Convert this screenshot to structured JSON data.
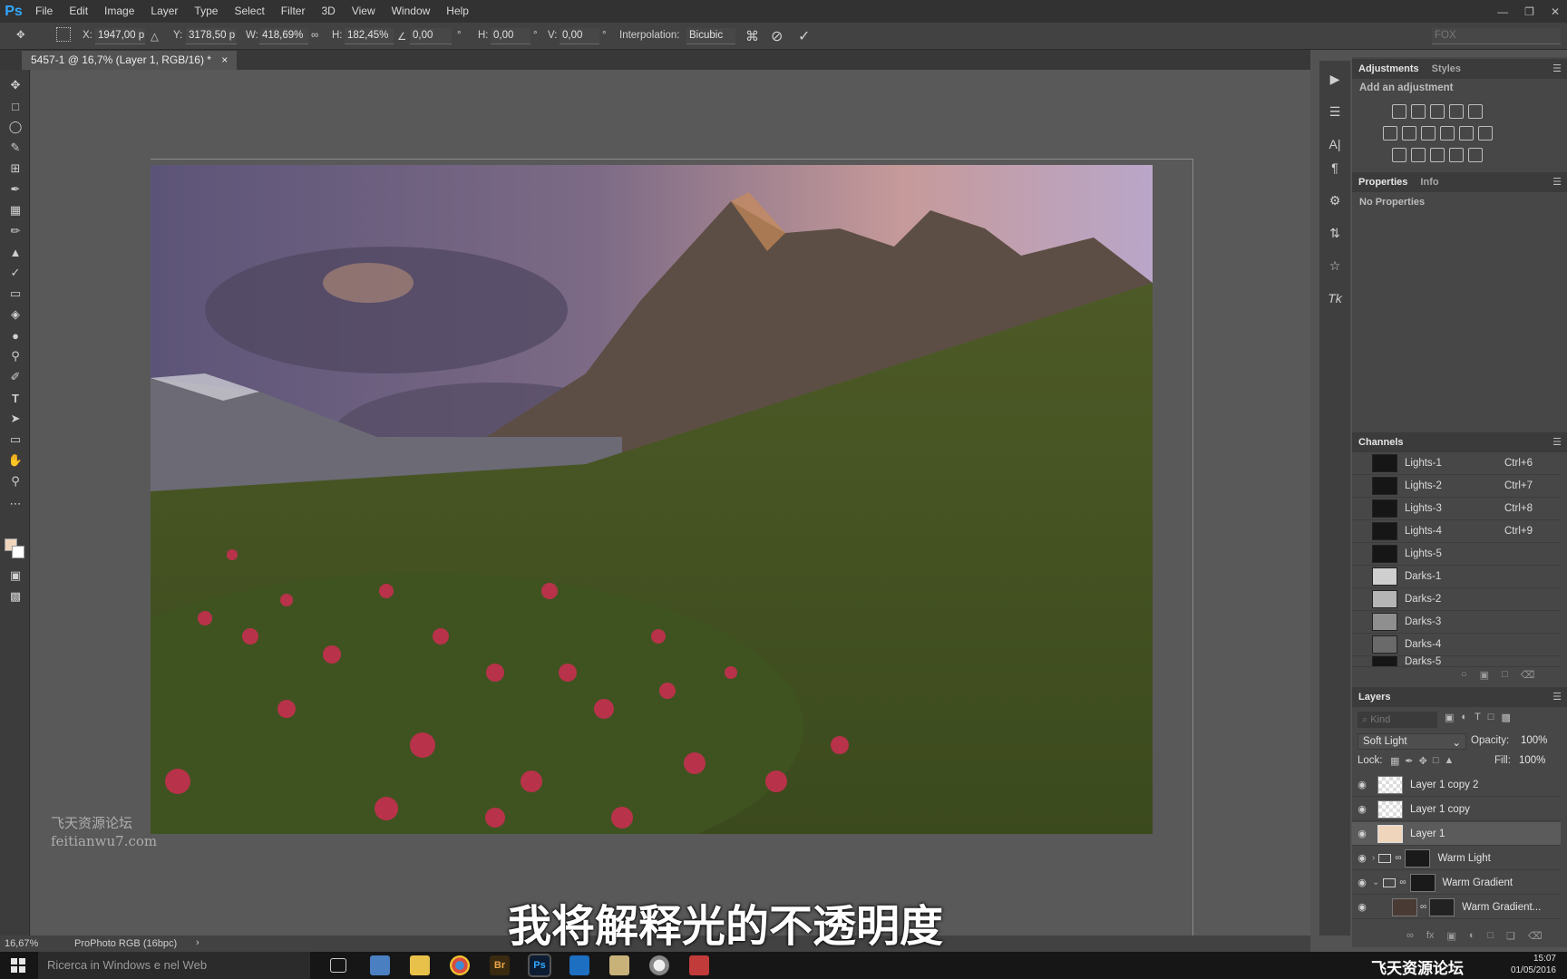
{
  "app": {
    "name": "Ps"
  },
  "menubar": {
    "items": [
      "File",
      "Edit",
      "Image",
      "Layer",
      "Type",
      "Select",
      "Filter",
      "3D",
      "View",
      "Window",
      "Help"
    ]
  },
  "options": {
    "x_label": "X:",
    "x_value": "1947,00 p",
    "y_label": "Y:",
    "y_value": "3178,50 p",
    "w_label": "W:",
    "w_value": "418,69%",
    "h_label": "H:",
    "h_value": "182,45%",
    "angle_value": "0,00",
    "angle_unit": "°",
    "hskew_label": "H:",
    "hskew_value": "0,00",
    "hskew_unit": "°",
    "vskew_label": "V:",
    "vskew_value": "0,00",
    "vskew_unit": "°",
    "interp_label": "Interpolation:",
    "interp_value": "Bicubic",
    "right_field": "FOX"
  },
  "document": {
    "tab_title": "5457-1 @ 16,7% (Layer 1, RGB/16) *",
    "close": "×"
  },
  "status": {
    "zoom": "16,67%",
    "profile": "ProPhoto RGB (16bpc)"
  },
  "watermark": {
    "line1": "飞天资源论坛",
    "line2": "feitianwu7.com"
  },
  "subtitle": "我将解释光的不透明度",
  "adjustments": {
    "tab_active": "Adjustments",
    "tab_other": "Styles",
    "hint": "Add an adjustment"
  },
  "properties": {
    "tab_active": "Properties",
    "tab_other": "Info",
    "message": "No Properties"
  },
  "channels": {
    "title": "Channels",
    "rows": [
      {
        "name": "Lights-1",
        "key": "Ctrl+6"
      },
      {
        "name": "Lights-2",
        "key": "Ctrl+7"
      },
      {
        "name": "Lights-3",
        "key": "Ctrl+8"
      },
      {
        "name": "Lights-4",
        "key": "Ctrl+9"
      },
      {
        "name": "Lights-5",
        "key": ""
      },
      {
        "name": "Darks-1",
        "key": ""
      },
      {
        "name": "Darks-2",
        "key": ""
      },
      {
        "name": "Darks-3",
        "key": ""
      },
      {
        "name": "Darks-4",
        "key": ""
      },
      {
        "name": "Darks-5",
        "key": ""
      }
    ]
  },
  "layers": {
    "title": "Layers",
    "kind_placeholder": "Kind",
    "blend_mode": "Soft Light",
    "opacity_label": "Opacity:",
    "opacity_value": "100%",
    "lock_label": "Lock:",
    "fill_label": "Fill:",
    "fill_value": "100%",
    "rows": [
      {
        "name": "Layer 1 copy 2",
        "selected": false
      },
      {
        "name": "Layer 1 copy",
        "selected": false
      },
      {
        "name": "Layer 1",
        "selected": true
      },
      {
        "name": "Warm Light",
        "selected": false
      },
      {
        "name": "Warm Gradient",
        "selected": false
      },
      {
        "name": "Warm Gradient...",
        "selected": false
      }
    ]
  },
  "taskbar": {
    "search_placeholder": "Ricerca in Windows e nel Web",
    "clock_time": "15:07",
    "clock_date": "01/05/2016",
    "tray_text": "飞天资源论坛"
  }
}
